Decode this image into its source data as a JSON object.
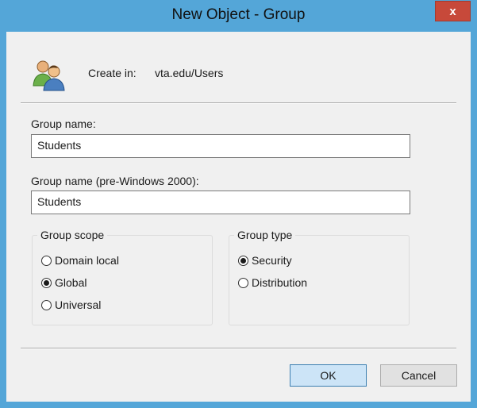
{
  "window": {
    "title": "New Object - Group",
    "close_label": "x"
  },
  "header": {
    "create_in_label": "Create in:",
    "create_in_value": "vta.edu/Users",
    "icon": "users-icon"
  },
  "group_name": {
    "label": "Group name:",
    "value": "Students"
  },
  "group_name_pre2000": {
    "label": "Group name (pre-Windows 2000):",
    "value": "Students"
  },
  "group_scope": {
    "legend": "Group scope",
    "options": [
      {
        "label": "Domain local",
        "checked": false
      },
      {
        "label": "Global",
        "checked": true
      },
      {
        "label": "Universal",
        "checked": false
      }
    ]
  },
  "group_type": {
    "legend": "Group type",
    "options": [
      {
        "label": "Security",
        "checked": true
      },
      {
        "label": "Distribution",
        "checked": false
      }
    ]
  },
  "buttons": {
    "ok": "OK",
    "cancel": "Cancel"
  },
  "colors": {
    "frame": "#54a6d8",
    "close": "#c7493a",
    "ok_button": "#cce4f7"
  }
}
